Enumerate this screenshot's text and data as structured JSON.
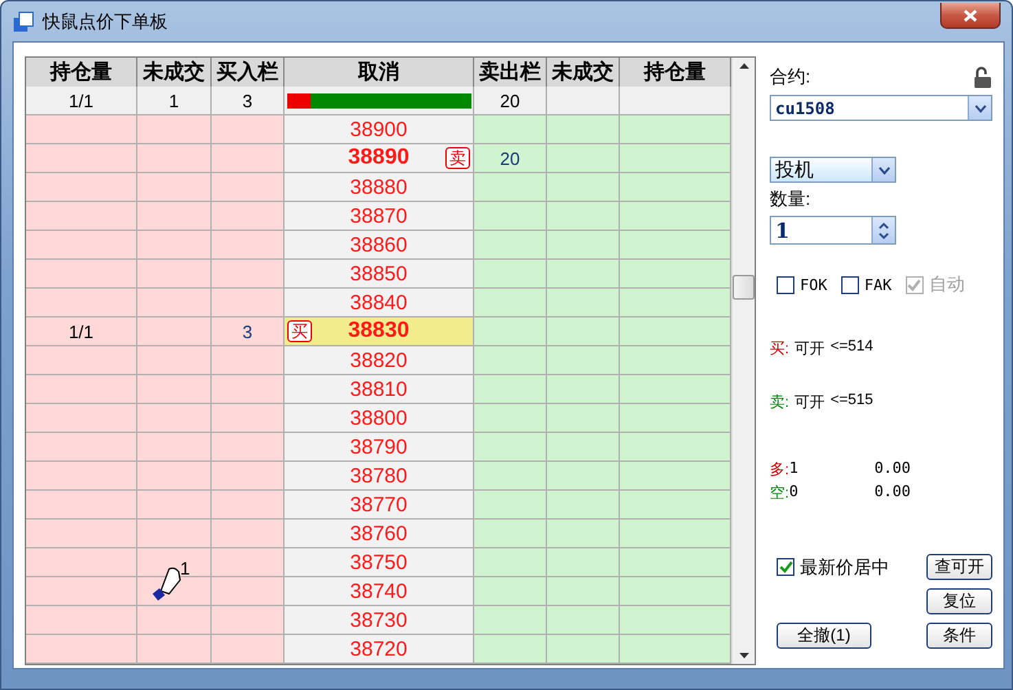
{
  "window": {
    "title": "快鼠点价下单板"
  },
  "table": {
    "columns": [
      "持仓量",
      "未成交",
      "买入栏",
      "取消",
      "卖出栏",
      "未成交",
      "持仓量"
    ],
    "summary": {
      "buy_position": "1/1",
      "buy_pending": "1",
      "buy_qty": "3",
      "level": 0.13,
      "sell_qty": "20"
    },
    "rows": [
      {
        "price": "38900",
        "current": false
      },
      {
        "price": "38890",
        "current": false,
        "marker": {
          "text": "卖",
          "kind": "sell"
        },
        "sell_qty": "20"
      },
      {
        "price": "38880",
        "current": false
      },
      {
        "price": "38870",
        "current": false
      },
      {
        "price": "38860",
        "current": false
      },
      {
        "price": "38850",
        "current": false
      },
      {
        "price": "38840",
        "current": false
      },
      {
        "price": "38830",
        "current": true,
        "marker": {
          "text": "买",
          "kind": "buy"
        },
        "buy_position": "1/1",
        "buy_qty": "3"
      },
      {
        "price": "38820",
        "current": false
      },
      {
        "price": "38810",
        "current": false
      },
      {
        "price": "38800",
        "current": false
      },
      {
        "price": "38790",
        "current": false
      },
      {
        "price": "38780",
        "current": false
      },
      {
        "price": "38770",
        "current": false
      },
      {
        "price": "38760",
        "current": false
      },
      {
        "price": "38750",
        "current": false
      },
      {
        "price": "38740",
        "current": false
      },
      {
        "price": "38730",
        "current": false
      },
      {
        "price": "38720",
        "current": false
      }
    ]
  },
  "cursor": {
    "label": "1"
  },
  "panel": {
    "contract_label": "合约:",
    "contract": "cu1508",
    "hedge_type": "投机",
    "quantity_label": "数量:",
    "quantity": "1",
    "options": [
      {
        "label": "FOK",
        "checked": false,
        "disabled": false
      },
      {
        "label": "FAK",
        "checked": false,
        "disabled": false
      },
      {
        "label": "自动",
        "checked": true,
        "disabled": true
      }
    ],
    "availability": [
      {
        "side": "买:",
        "color": "#cc0000",
        "text": "可开",
        "limit": "<=514"
      },
      {
        "side": "卖:",
        "color": "#008000",
        "text": "可开",
        "limit": "<=515"
      }
    ],
    "positions": [
      {
        "side": "多:",
        "color": "#cc0000",
        "count": "1",
        "value": "0.00"
      },
      {
        "side": "空:",
        "color": "#008000",
        "count": "0",
        "value": "0.00"
      }
    ],
    "center_latest": {
      "label": "最新价居中",
      "checked": true
    },
    "buttons": [
      "查可开",
      "复位",
      "全撤(1)",
      "条件"
    ]
  }
}
